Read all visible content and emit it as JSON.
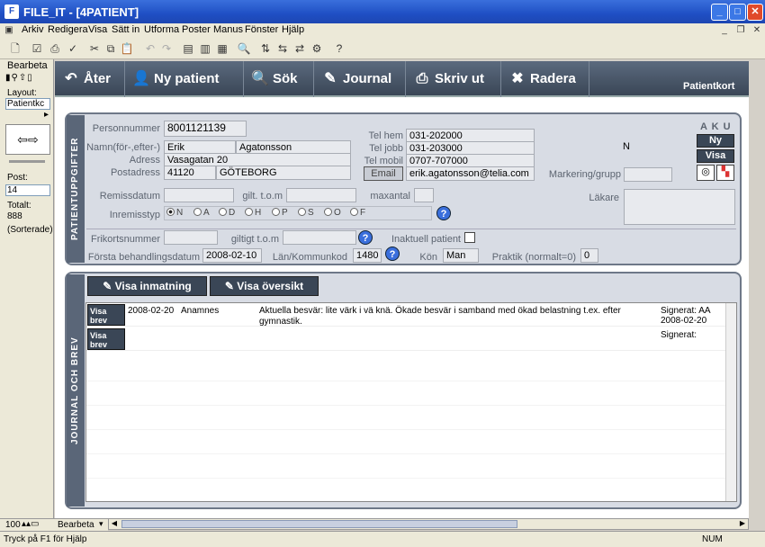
{
  "window": {
    "title": "FILE_IT - [4PATIENT]"
  },
  "menu": [
    "Arkiv",
    "Redigera",
    "Visa",
    "Sätt in",
    "Utforma",
    "Poster",
    "Manus",
    "Fönster",
    "Hjälp"
  ],
  "left": {
    "mode": "Bearbeta",
    "layout_label": "Layout:",
    "layout_value": "Patientkc",
    "post_label": "Post:",
    "post_value": "14",
    "total_label": "Totalt:",
    "total_value": "888",
    "sorted": "(Sorterade)"
  },
  "nav": {
    "back": "Åter",
    "new_patient": "Ny patient",
    "search": "Sök",
    "journal": "Journal",
    "print": "Skriv ut",
    "delete": "Radera",
    "form_title": "Patientkort"
  },
  "patient": {
    "tab_label": "PATIENTUPPGIFTER",
    "pnr_label": "Personnummer",
    "pnr": "8001121139",
    "name_label": "Namn(för-,efter-)",
    "first": "Erik",
    "last": "Agatonsson",
    "addr_label": "Adress",
    "addr": "Vasagatan 20",
    "postaddr_label": "Postadress",
    "zip": "41120",
    "city": "GÖTEBORG",
    "telhem_label": "Tel hem",
    "telhem": "031-202000",
    "teljobb_label": "Tel jobb",
    "teljobb": "031-203000",
    "telmob_label": "Tel mobil",
    "telmob": "0707-707000",
    "email_btn": "Email",
    "email": "erik.agatonsson@telia.com",
    "aku_label": "A K U",
    "aku_value": "N",
    "ny_btn": "Ny",
    "visa_btn": "Visa",
    "marker_label": "Markering/grupp",
    "remiss_label": "Remissdatum",
    "gilt_label": "gilt. t.o.m",
    "maxantal_label": "maxantal",
    "inremiss_label": "Inremisstyp",
    "radios": [
      "N",
      "A",
      "D",
      "H",
      "P",
      "S",
      "O",
      "F"
    ],
    "lakare_label": "Läkare",
    "frikort_label": "Frikortsnummer",
    "giltigt_label": "giltigt t.o.m",
    "inaktuell_label": "Inaktuell patient",
    "forsta_label": "Första behandlingsdatum",
    "forsta": "2008-02-10",
    "lan_label": "Län/Kommunkod",
    "lan": "1480",
    "kon_label": "Kön",
    "kon": "Man",
    "praktik_label": "Praktik (normalt=0)",
    "praktik": "0"
  },
  "journal": {
    "tab_label": "JOURNAL OCH BREV",
    "visa_inmatning": "Visa inmatning",
    "visa_oversikt": "Visa översikt",
    "rows": [
      {
        "btn": "Visa brev",
        "date": "2008-02-20",
        "type": "Anamnes",
        "text": "Aktuella besvär: lite värk i vä knä. Ökade besvär i samband med ökad belastning t.ex. efter gymnastik.",
        "signed": "Signerat: AA",
        "signed_date": "2008-02-20"
      },
      {
        "btn": "Visa brev",
        "date": "",
        "type": "",
        "text": "",
        "signed": "Signerat:",
        "signed_date": ""
      }
    ]
  },
  "bottom": {
    "zoom": "100",
    "mode": "Bearbeta"
  },
  "status": {
    "hint": "Tryck på F1 för Hjälp",
    "num": "NUM"
  }
}
